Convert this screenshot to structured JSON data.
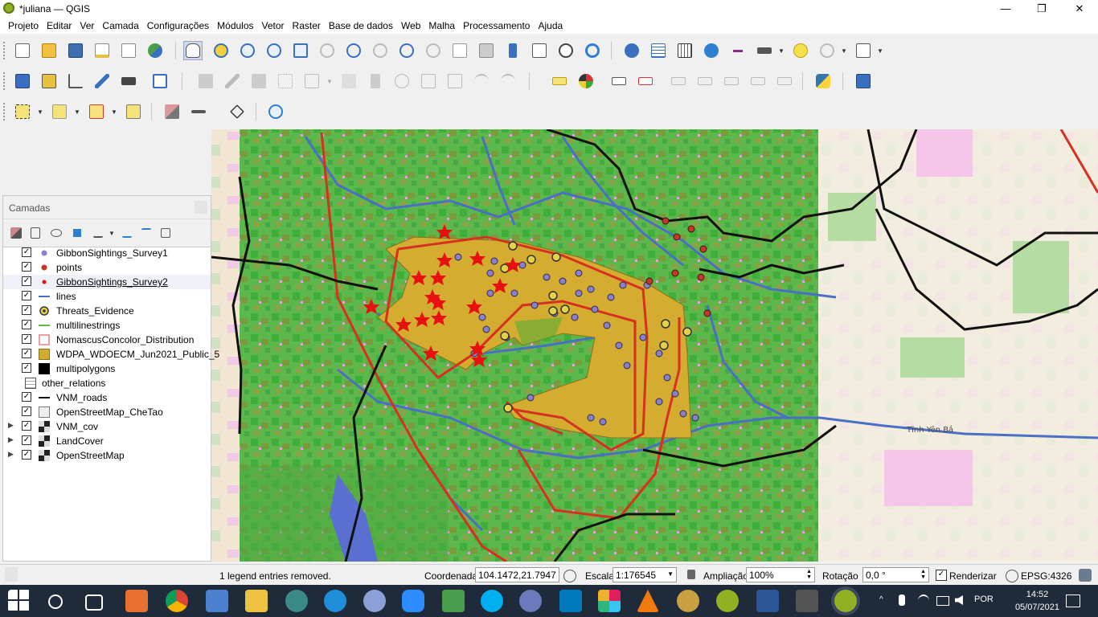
{
  "window": {
    "title": "*juliana — QGIS",
    "minimize": "—",
    "maximize": "❐",
    "close": "✕"
  },
  "menu": [
    "Projeto",
    "Editar",
    "Ver",
    "Camada",
    "Configurações",
    "Módulos",
    "Vetor",
    "Raster",
    "Base de dados",
    "Web",
    "Malha",
    "Processamento",
    "Ajuda"
  ],
  "layers_panel": {
    "title": "Camadas",
    "items": [
      {
        "label": "GibbonSightings_Survey1",
        "checked": true,
        "symbol": "purple-dot-icon",
        "expand": ""
      },
      {
        "label": "points",
        "checked": true,
        "symbol": "red-dot-icon",
        "expand": ""
      },
      {
        "label": "GibbonSightings_Survey2",
        "checked": true,
        "symbol": "red-star-icon",
        "expand": "",
        "selected": true
      },
      {
        "label": "lines",
        "checked": true,
        "symbol": "blue-line-icon",
        "expand": ""
      },
      {
        "label": "Threats_Evidence",
        "checked": true,
        "symbol": "target-dot-icon",
        "expand": ""
      },
      {
        "label": "multilinestrings",
        "checked": true,
        "symbol": "green-line-icon",
        "expand": ""
      },
      {
        "label": "NomascusConcolor_Distribution",
        "checked": true,
        "symbol": "red-outline-polygon-icon",
        "expand": ""
      },
      {
        "label": "WDPA_WDOECM_Jun2021_Public_5",
        "checked": true,
        "symbol": "yellow-polygon-icon",
        "expand": ""
      },
      {
        "label": "multipolygons",
        "checked": true,
        "symbol": "black-polygon-icon",
        "expand": ""
      },
      {
        "label": "other_relations",
        "checked": false,
        "symbol": "table-icon",
        "expand": ""
      },
      {
        "label": "VNM_roads",
        "checked": true,
        "symbol": "black-line-icon",
        "expand": ""
      },
      {
        "label": "OpenStreetMap_CheTao",
        "checked": true,
        "symbol": "osm-tile-icon",
        "expand": ""
      },
      {
        "label": "VNM_cov",
        "checked": true,
        "symbol": "raster-icon",
        "expand": "▶"
      },
      {
        "label": "LandCover",
        "checked": true,
        "symbol": "raster-icon",
        "expand": "▶"
      },
      {
        "label": "OpenStreetMap",
        "checked": true,
        "symbol": "raster-icon",
        "expand": "▶"
      }
    ]
  },
  "map": {
    "place_label": "Tĩnh Yên Bắ"
  },
  "status": {
    "message": "1 legend entries removed.",
    "coord_label": "Coordenada",
    "coord_value": "104.1472,21.7947",
    "scale_label": "Escala",
    "scale_value": "1:176545",
    "zoom_label": "Ampliação",
    "zoom_value": "100%",
    "rotation_label": "Rotação",
    "rotation_value": "0,0 °",
    "render_label": "Renderizar",
    "crs": "EPSG:4326"
  },
  "taskbar": {
    "language": "POR",
    "time": "14:52",
    "date": "05/07/2021"
  },
  "colors": {
    "wdpa_fill": "#d4ac2f",
    "distribution_outline": "#d7301f",
    "river": "#4a6fc4",
    "road": "#111111",
    "sighting1": "#8b7fc8",
    "sighting2": "#e8110f"
  }
}
